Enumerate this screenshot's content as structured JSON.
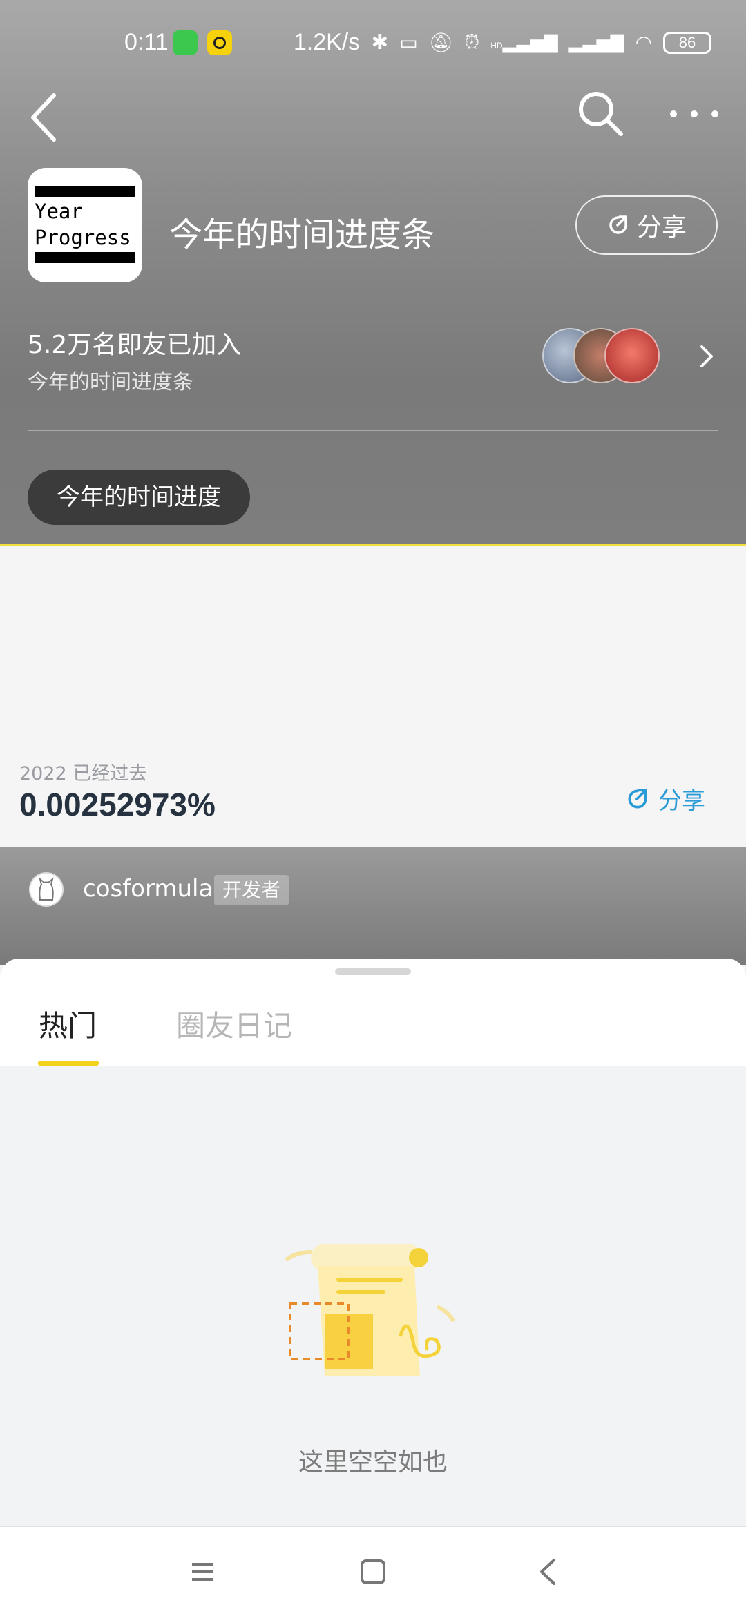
{
  "status_bar": {
    "time": "0:11",
    "speed": "1.2K/s",
    "battery": "86",
    "network_label": "HD"
  },
  "header": {
    "app_icon_text_line1": "Year",
    "app_icon_text_line2": "Progress",
    "title": "今年的时间进度条",
    "share_label": "分享",
    "members_count": "5.2万名即友已加入",
    "members_sub": "今年的时间进度条",
    "tag": "今年的时间进度"
  },
  "progress": {
    "year_label": "2022 已经过去",
    "value": "0.00252973%",
    "share_label": "分享"
  },
  "developer": {
    "name": "cosformula",
    "badge": "开发者"
  },
  "tabs": {
    "hot": "热门",
    "diary": "圈友日记"
  },
  "empty_state": {
    "text": "这里空空如也"
  },
  "colors": {
    "accent_yellow": "#f3d21c",
    "link_blue": "#2a9bd6",
    "header_grey": "#8c8c8c"
  },
  "icons": [
    "back-icon",
    "search-icon",
    "more-icon",
    "share-icon",
    "chevron-right-icon",
    "menu-icon",
    "home-icon",
    "nav-back-icon"
  ]
}
